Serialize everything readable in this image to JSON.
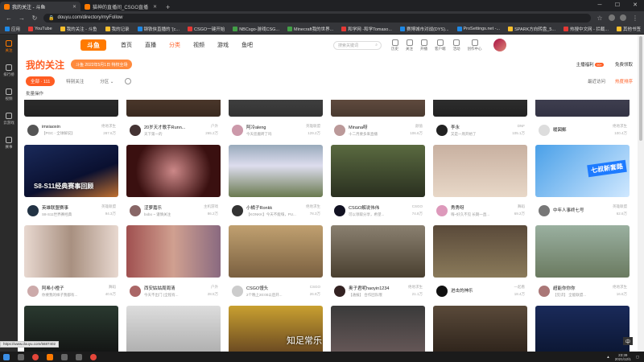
{
  "browser": {
    "tabs": [
      {
        "title": "我的关注 - 斗鱼",
        "active": true
      },
      {
        "title": "猫神的直播间_CSGO直播",
        "active": false
      }
    ],
    "url": "douyu.com/directory/myFollow",
    "bookmarks": [
      "应用",
      "YouTube",
      "我的关注 - 斗鱼",
      "我的记录",
      "钢铁侠直播的 '[c...",
      "CSGO一键开始",
      "NBCsgo-游戏CSG...",
      "Minecraft我的世界...",
      "和学网 -和学Tomaso...",
      "赛博城市对战(DYS)...",
      "ProSettings.net -...",
      "SPARK方向转盘_5...",
      "热搜中文网 - 拦截...",
      "其他书签"
    ]
  },
  "sidebar": [
    {
      "label": "关注",
      "icon": "heart-icon",
      "active": true
    },
    {
      "label": "排行榜",
      "icon": "rank-icon",
      "active": false
    },
    {
      "label": "视频",
      "icon": "video-icon",
      "active": false
    },
    {
      "label": "云游戏",
      "icon": "cloud-game-icon",
      "active": false
    },
    {
      "label": "赛事",
      "icon": "trophy-icon",
      "active": false
    }
  ],
  "header": {
    "logo": "斗鱼",
    "nav": [
      "首页",
      "直播",
      "分类",
      "视频",
      "游戏",
      "鱼吧"
    ],
    "search_placeholder": "搜索关键词",
    "icons": [
      "历史",
      "关注",
      "开播",
      "客户端",
      "活动",
      "创作中心"
    ]
  },
  "page": {
    "title": "我的关注",
    "promo": "斗鱼 2022年5月1日 特权全场",
    "assistant": "主播福利",
    "assistant_badge": "99+",
    "free_gift": "免费领取"
  },
  "filters": {
    "all": "全部 · 111",
    "special": "特别关注",
    "section": "分区",
    "sort_recent": "最近访问",
    "sort_hot": "热度排序",
    "batch": "批量操作"
  },
  "rows": [
    [
      {
        "name": "imxiaoxin",
        "sub": "【PGC - 全球解说】",
        "cat": "绝地求生",
        "hot": "287.6万"
      },
      {
        "name": "20岁天才歌手Runn...",
        "sub": "天下第一的",
        "cat": "户外",
        "hot": "265.2万"
      },
      {
        "name": "阿冷aleng",
        "sub": "今天您搬砖了吗",
        "cat": "英雄联盟",
        "hot": "129.2万"
      },
      {
        "name": "Minana呀",
        "sub": "十二月要多来直播",
        "cat": "颜值",
        "hot": "106.6万"
      },
      {
        "name": "李永",
        "sub": "又是一周开始了",
        "cat": "DNF",
        "hot": "105.1万"
      },
      {
        "name": "暖図郵",
        "sub": "",
        "cat": "绝地求生",
        "hot": "100.4万"
      }
    ],
    [
      {
        "name": "英雄联盟赛事",
        "sub": "S8-S11世界赛经典",
        "cat": "英雄联盟",
        "hot": "94.3万",
        "overlay": "S8-S11经典赛事回顾"
      },
      {
        "name": "涩萝嘉乐",
        "sub": "bobo ~ 谨慎关注",
        "cat": "主机游戏",
        "hot": "86.2万"
      },
      {
        "name": "小橘子Ronkk",
        "sub": "【KONKK】今天不能嗨，PU...",
        "cat": "绝地求生",
        "hot": "78.3万"
      },
      {
        "name": "CSGO解说伟伟",
        "sub": "可以领取分享，希望...",
        "cat": "CSGO",
        "hot": "74.8万"
      },
      {
        "name": "秀秀呀",
        "sub": "嗨~好久不见 长期一直...",
        "cat": "舞蹈",
        "hot": "69.2万"
      },
      {
        "name": "中年人事终七号",
        "sub": "",
        "cat": "英雄联盟",
        "hot": "62.6万",
        "banner": "七叔新套路"
      }
    ],
    [
      {
        "name": "阿希小橙子",
        "sub": "你要我的样子我都有...",
        "cat": "舞蹈",
        "hot": "40.5万"
      },
      {
        "name": "西安姑姑周周清",
        "sub": "今天不出门 (全程有...",
        "cat": "户外",
        "hot": "28.5万"
      },
      {
        "name": "CSGO馒头",
        "sub": "2个晚上20:00以后开...",
        "cat": "CSGO",
        "hot": "26.9万"
      },
      {
        "name": "奥子君呢haoyin1234",
        "sub": "【通报】 合作团队哦",
        "cat": "绝地求生",
        "hot": "21.1万"
      },
      {
        "name": "进击的神乐",
        "sub": "",
        "cat": "一起看",
        "hot": "18.4万"
      },
      {
        "name": "超能你你你",
        "sub": "【见识】 全能联盟...",
        "cat": "绝地求生",
        "hot": "16.6万"
      }
    ]
  ],
  "status_url": "https://www.douyu.com/5687402",
  "subtitle": "知足常乐",
  "taskbar": {
    "time": "23:39",
    "date": "2021/12/1",
    "ime": "中"
  }
}
